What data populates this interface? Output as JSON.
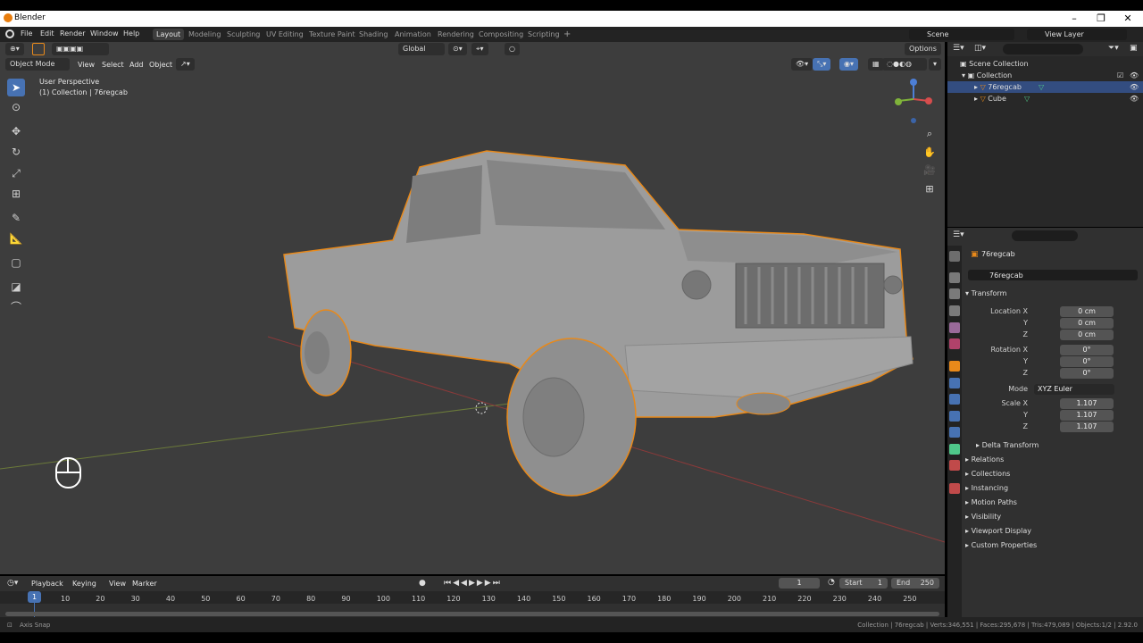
{
  "window": {
    "title": "Blender"
  },
  "menu": [
    "File",
    "Edit",
    "Render",
    "Window",
    "Help"
  ],
  "workspaces": [
    "Layout",
    "Modeling",
    "Sculpting",
    "UV Editing",
    "Texture Paint",
    "Shading",
    "Animation",
    "Rendering",
    "Compositing",
    "Scripting"
  ],
  "scene": "Scene",
  "view_layer": "View Layer",
  "viewport": {
    "mode": "Object Mode",
    "menus": [
      "View",
      "Select",
      "Add",
      "Object"
    ],
    "orientation": "Global",
    "options": "Options",
    "perspective": "User Perspective",
    "collection_info": "(1) Collection | 76regcab"
  },
  "outliner": {
    "root": "Scene Collection",
    "items": [
      {
        "label": "Collection"
      },
      {
        "label": "76regcab"
      },
      {
        "label": "Cube"
      }
    ]
  },
  "properties": {
    "object_name": "76regcab",
    "data_name": "76regcab",
    "transform_title": "Transform",
    "location": [
      {
        "axis": "Location X",
        "value": "0 cm"
      },
      {
        "axis": "Y",
        "value": "0 cm"
      },
      {
        "axis": "Z",
        "value": "0 cm"
      }
    ],
    "rotation": [
      {
        "axis": "Rotation X",
        "value": "0°"
      },
      {
        "axis": "Y",
        "value": "0°"
      },
      {
        "axis": "Z",
        "value": "0°"
      }
    ],
    "mode_label": "Mode",
    "mode_value": "XYZ Euler",
    "scale": [
      {
        "axis": "Scale X",
        "value": "1.107"
      },
      {
        "axis": "Y",
        "value": "1.107"
      },
      {
        "axis": "Z",
        "value": "1.107"
      }
    ],
    "delta": "Delta Transform",
    "panels": [
      "Relations",
      "Collections",
      "Instancing",
      "Motion Paths",
      "Visibility",
      "Viewport Display",
      "Custom Properties"
    ]
  },
  "timeline": {
    "menus": [
      "Playback",
      "Keying",
      "View",
      "Marker"
    ],
    "current_frame": "1",
    "start_label": "Start",
    "start": "1",
    "end_label": "End",
    "end": "250",
    "ticks": [
      "10",
      "20",
      "30",
      "40",
      "50",
      "60",
      "70",
      "80",
      "90",
      "100",
      "110",
      "120",
      "130",
      "140",
      "150",
      "160",
      "170",
      "180",
      "190",
      "200",
      "210",
      "220",
      "230",
      "240",
      "250"
    ],
    "playhead": "1"
  },
  "status": {
    "left": "Axis Snap",
    "right": "Collection | 76regcab | Verts:346,551 | Faces:295,678 | Tris:479,089 | Objects:1/2 | 2.92.0"
  },
  "colors": {
    "accent": "#4772b3",
    "selection": "#e87d0d",
    "viewport_bg": "#3d3d3d"
  }
}
